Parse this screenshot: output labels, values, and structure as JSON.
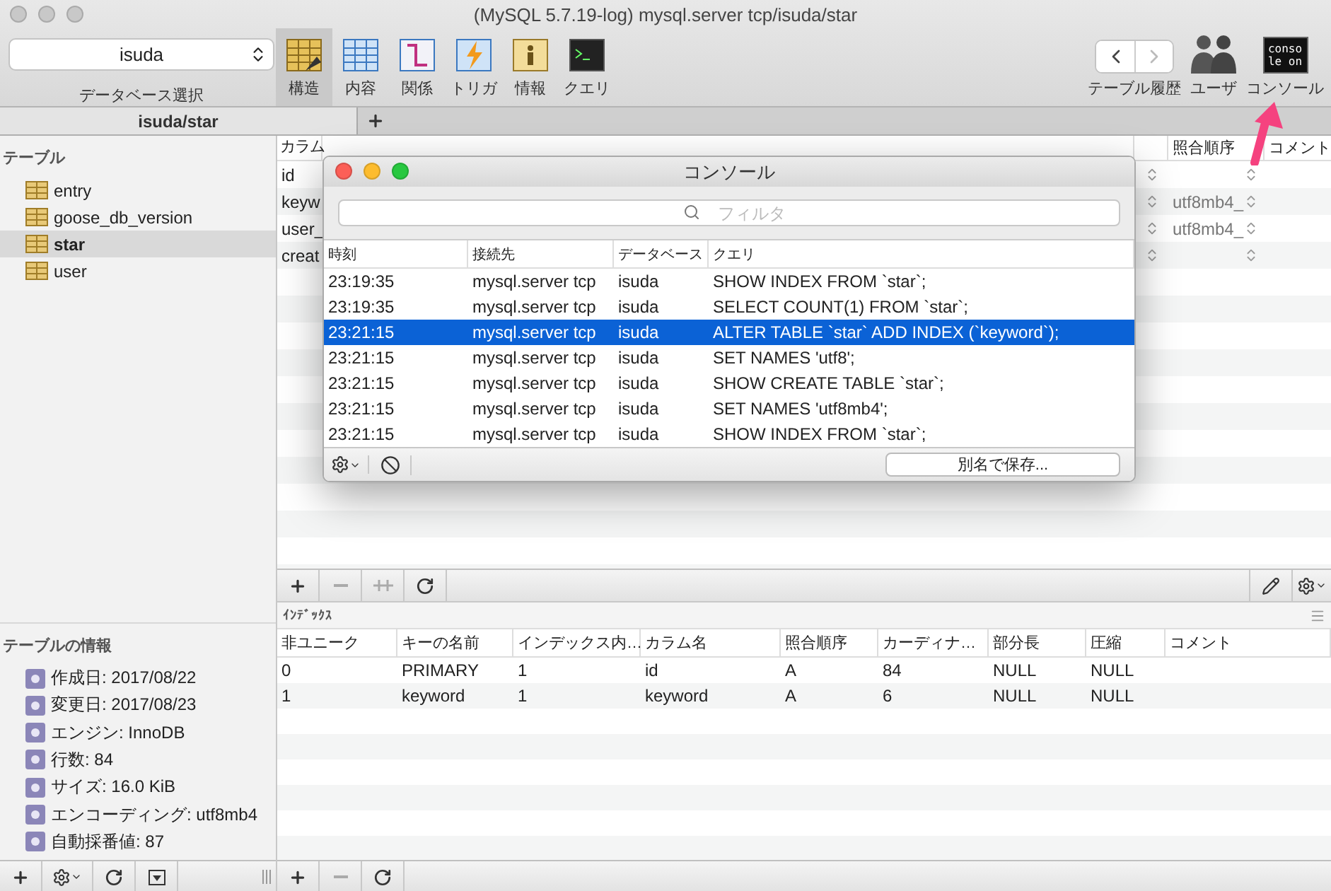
{
  "window": {
    "title": "(MySQL 5.7.19-log) mysql.server tcp/isuda/star"
  },
  "toolbar": {
    "database": {
      "value": "isuda",
      "label": "データベース選択"
    },
    "views": [
      {
        "label": "構造",
        "kind": "structure",
        "selected": true
      },
      {
        "label": "内容",
        "kind": "content",
        "selected": false
      },
      {
        "label": "関係",
        "kind": "relations",
        "selected": false
      },
      {
        "label": "トリガ",
        "kind": "triggers",
        "selected": false
      },
      {
        "label": "情報",
        "kind": "info",
        "selected": false
      },
      {
        "label": "クエリ",
        "kind": "query",
        "selected": false
      }
    ],
    "history_label": "テーブル履歴",
    "users_label": "ユーザ",
    "console_label": "コンソール",
    "console_icon_lines": [
      "conso",
      "le on"
    ]
  },
  "tabs": [
    {
      "label": "isuda/star",
      "selected": true
    }
  ],
  "sidebar": {
    "heading": "テーブル",
    "tables": [
      {
        "name": "entry",
        "selected": false
      },
      {
        "name": "goose_db_version",
        "selected": false
      },
      {
        "name": "star",
        "selected": true
      },
      {
        "name": "user",
        "selected": false
      }
    ],
    "info_heading": "テーブルの情報",
    "info": [
      "作成日: 2017/08/22",
      "変更日: 2017/08/23",
      "エンジン: InnoDB",
      "行数: 84",
      "サイズ: 16.0 KiB",
      "エンコーディング: utf8mb4",
      "自動採番値: 87"
    ]
  },
  "structure": {
    "columns": [
      "カラム",
      "照合順序",
      "コメント"
    ],
    "rows": [
      {
        "field": "id",
        "collation": ""
      },
      {
        "field": "keyw",
        "collation": "utf8mb4_"
      },
      {
        "field": "user_",
        "collation": "utf8mb4_"
      },
      {
        "field": "creat",
        "collation": ""
      }
    ]
  },
  "console": {
    "title": "コンソール",
    "filter_placeholder": "フィルタ",
    "columns": [
      "時刻",
      "接続先",
      "データベース",
      "クエリ"
    ],
    "rows": [
      {
        "time": "23:19:35",
        "connection": "mysql.server tcp",
        "database": "isuda",
        "query": "SHOW INDEX FROM `star`;",
        "selected": false
      },
      {
        "time": "23:19:35",
        "connection": "mysql.server tcp",
        "database": "isuda",
        "query": "SELECT COUNT(1) FROM `star`;",
        "selected": false
      },
      {
        "time": "23:21:15",
        "connection": "mysql.server tcp",
        "database": "isuda",
        "query": "ALTER TABLE `star` ADD INDEX (`keyword`);",
        "selected": true
      },
      {
        "time": "23:21:15",
        "connection": "mysql.server tcp",
        "database": "isuda",
        "query": "SET NAMES 'utf8';",
        "selected": false
      },
      {
        "time": "23:21:15",
        "connection": "mysql.server tcp",
        "database": "isuda",
        "query": "SHOW CREATE TABLE `star`;",
        "selected": false
      },
      {
        "time": "23:21:15",
        "connection": "mysql.server tcp",
        "database": "isuda",
        "query": "SET NAMES 'utf8mb4';",
        "selected": false
      },
      {
        "time": "23:21:15",
        "connection": "mysql.server tcp",
        "database": "isuda",
        "query": "SHOW INDEX FROM `star`;",
        "selected": false
      }
    ],
    "save_button": "別名で保存..."
  },
  "indexes": {
    "title": "ｲﾝﾃﾞｯｸｽ",
    "columns": [
      "非ユニーク",
      "キーの名前",
      "インデックス内…",
      "カラム名",
      "照合順序",
      "カーディナ…",
      "部分長",
      "圧縮",
      "コメント"
    ],
    "rows": [
      [
        "0",
        "PRIMARY",
        "1",
        "id",
        "A",
        "84",
        "NULL",
        "NULL",
        ""
      ],
      [
        "1",
        "keyword",
        "1",
        "keyword",
        "A",
        "6",
        "NULL",
        "NULL",
        ""
      ]
    ]
  }
}
